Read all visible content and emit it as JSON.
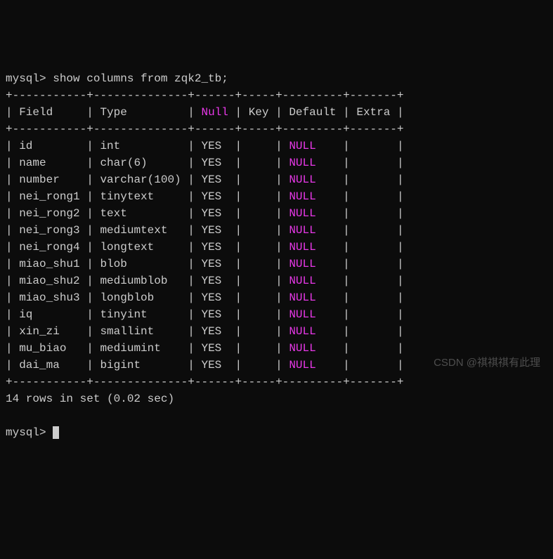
{
  "prompt": "mysql>",
  "command": "show columns from zqk2_tb;",
  "separator": "+-----------+--------------+------+-----+---------+-------+",
  "headers": {
    "field": "Field",
    "type": "Type",
    "null": "Null",
    "key": "Key",
    "default": "Default",
    "extra": "Extra"
  },
  "rows": [
    {
      "field": "id",
      "type": "int",
      "null": "YES",
      "key": "",
      "default": "NULL",
      "extra": ""
    },
    {
      "field": "name",
      "type": "char(6)",
      "null": "YES",
      "key": "",
      "default": "NULL",
      "extra": ""
    },
    {
      "field": "number",
      "type": "varchar(100)",
      "null": "YES",
      "key": "",
      "default": "NULL",
      "extra": ""
    },
    {
      "field": "nei_rong1",
      "type": "tinytext",
      "null": "YES",
      "key": "",
      "default": "NULL",
      "extra": ""
    },
    {
      "field": "nei_rong2",
      "type": "text",
      "null": "YES",
      "key": "",
      "default": "NULL",
      "extra": ""
    },
    {
      "field": "nei_rong3",
      "type": "mediumtext",
      "null": "YES",
      "key": "",
      "default": "NULL",
      "extra": ""
    },
    {
      "field": "nei_rong4",
      "type": "longtext",
      "null": "YES",
      "key": "",
      "default": "NULL",
      "extra": ""
    },
    {
      "field": "miao_shu1",
      "type": "blob",
      "null": "YES",
      "key": "",
      "default": "NULL",
      "extra": ""
    },
    {
      "field": "miao_shu2",
      "type": "mediumblob",
      "null": "YES",
      "key": "",
      "default": "NULL",
      "extra": ""
    },
    {
      "field": "miao_shu3",
      "type": "longblob",
      "null": "YES",
      "key": "",
      "default": "NULL",
      "extra": ""
    },
    {
      "field": "iq",
      "type": "tinyint",
      "null": "YES",
      "key": "",
      "default": "NULL",
      "extra": ""
    },
    {
      "field": "xin_zi",
      "type": "smallint",
      "null": "YES",
      "key": "",
      "default": "NULL",
      "extra": ""
    },
    {
      "field": "mu_biao",
      "type": "mediumint",
      "null": "YES",
      "key": "",
      "default": "NULL",
      "extra": ""
    },
    {
      "field": "dai_ma",
      "type": "bigint",
      "null": "YES",
      "key": "",
      "default": "NULL",
      "extra": ""
    }
  ],
  "footer": "14 rows in set (0.02 sec)",
  "watermark": "CSDN @祺祺祺有此理",
  "col_widths": {
    "field": 9,
    "type": 12,
    "null": 4,
    "key": 3,
    "default": 7,
    "extra": 5
  }
}
